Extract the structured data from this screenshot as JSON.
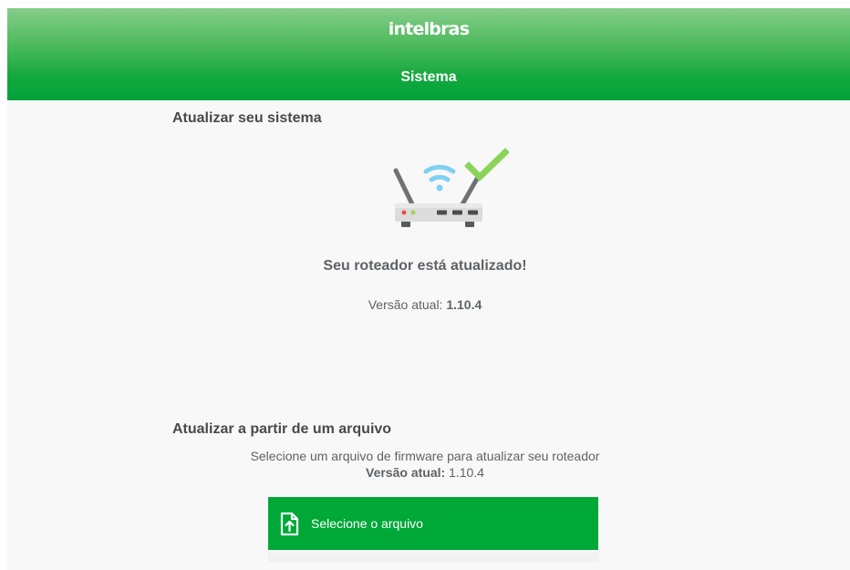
{
  "header": {
    "brand": "intelbras",
    "section": "Sistema"
  },
  "update_system": {
    "title": "Atualizar seu sistema",
    "status": "Seu roteador está atualizado!",
    "version_label": "Versão atual:",
    "version_value": "1.10.4"
  },
  "update_file": {
    "title": "Atualizar a partir de um arquivo",
    "description": "Selecione um arquivo de firmware para atualizar seu roteador",
    "version_label": "Versão atual:",
    "version_value": "1.10.4",
    "button_label": "Selecione o arquivo"
  },
  "colors": {
    "brand_green": "#00a838",
    "check_green": "#8bd35a",
    "wifi_blue": "#7fd2ef"
  },
  "icons": {
    "router": "router-updated-icon",
    "upload": "file-upload-icon"
  }
}
